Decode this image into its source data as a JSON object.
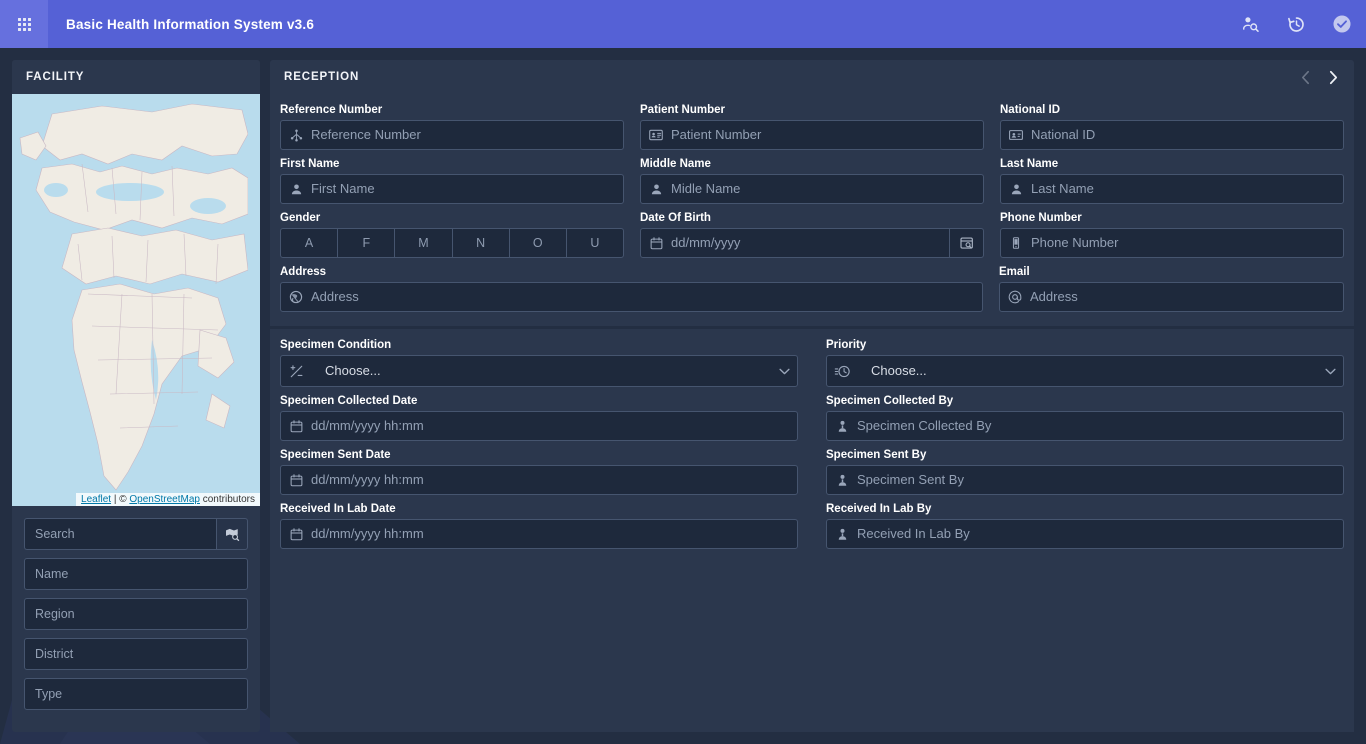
{
  "appbar": {
    "launcher_icon": "apps-grid-icon",
    "title": "Basic Health Information System v3.6",
    "actions": [
      {
        "name": "patient-search-icon",
        "label": "Search Patient"
      },
      {
        "name": "history-restore-icon",
        "label": "History"
      },
      {
        "name": "check-circle-icon",
        "label": "Confirm"
      }
    ]
  },
  "facility": {
    "title": "FACILITY",
    "map": {
      "attribution_prefix": "",
      "leaflet": "Leaflet",
      "separator": " | ",
      "copyright": "© ",
      "osm": "OpenStreetMap",
      "suffix": " contributors"
    },
    "search": {
      "placeholder": "Search",
      "button_icon": "map-search-icon"
    },
    "filters": [
      {
        "name": "facility-name-input",
        "placeholder": "Name"
      },
      {
        "name": "facility-region-input",
        "placeholder": "Region"
      },
      {
        "name": "facility-district-input",
        "placeholder": "District"
      },
      {
        "name": "facility-type-input",
        "placeholder": "Type"
      }
    ]
  },
  "reception": {
    "title": "RECEPTION",
    "nav": {
      "prev_icon": "chevron-left-icon",
      "next_icon": "chevron-right-icon",
      "prev_disabled": true
    },
    "patient": {
      "reference_number": {
        "label": "Reference Number",
        "placeholder": "Reference Number",
        "value": "",
        "icon": "hierarchy-icon"
      },
      "patient_number": {
        "label": "Patient Number",
        "placeholder": "Patient Number",
        "value": "",
        "icon": "id-card-icon"
      },
      "national_id": {
        "label": "National ID",
        "placeholder": "National ID",
        "value": "",
        "icon": "id-photo-icon"
      },
      "first_name": {
        "label": "First Name",
        "placeholder": "First Name",
        "value": "",
        "icon": "person-icon"
      },
      "middle_name": {
        "label": "Middle Name",
        "placeholder": "Midle Name",
        "value": "",
        "icon": "person-icon"
      },
      "last_name": {
        "label": "Last Name",
        "placeholder": "Last Name",
        "value": "",
        "icon": "person-icon"
      },
      "gender": {
        "label": "Gender",
        "options": [
          "A",
          "F",
          "M",
          "N",
          "O",
          "U"
        ],
        "selected": ""
      },
      "date_of_birth": {
        "label": "Date Of Birth",
        "placeholder": "dd/mm/yyyy",
        "value": "",
        "icon": "calendar-icon",
        "trailing_icon": "calendar-search-icon"
      },
      "phone_number": {
        "label": "Phone Number",
        "placeholder": "Phone Number",
        "value": "",
        "icon": "mobile-phone-icon"
      },
      "address": {
        "label": "Address",
        "placeholder": "Address",
        "value": "",
        "icon": "globe-icon"
      },
      "email": {
        "label": "Email",
        "placeholder": "Address",
        "value": "",
        "icon": "at-sign-icon"
      }
    },
    "specimen": {
      "specimen_condition": {
        "label": "Specimen Condition",
        "value": "Choose...",
        "icon": "plus-minus-icon",
        "caret": "chevron-down-icon"
      },
      "priority": {
        "label": "Priority",
        "value": "Choose...",
        "icon": "clock-list-icon",
        "caret": "chevron-down-icon"
      },
      "collected_date": {
        "label": "Specimen Collected Date",
        "placeholder": "dd/mm/yyyy hh:mm",
        "value": "",
        "icon": "calendar-icon"
      },
      "collected_by": {
        "label": "Specimen Collected By",
        "placeholder": "Specimen Collected By",
        "value": "",
        "icon": "doctor-icon"
      },
      "sent_date": {
        "label": "Specimen Sent Date",
        "placeholder": "dd/mm/yyyy hh:mm",
        "value": "",
        "icon": "calendar-icon"
      },
      "sent_by": {
        "label": "Specimen Sent By",
        "placeholder": "Specimen Sent By",
        "value": "",
        "icon": "doctor-icon"
      },
      "received_date": {
        "label": "Received In Lab Date",
        "placeholder": "dd/mm/yyyy hh:mm",
        "value": "",
        "icon": "calendar-icon"
      },
      "received_by": {
        "label": "Received In Lab By",
        "placeholder": "Received In Lab By",
        "value": "",
        "icon": "doctor-icon"
      }
    }
  },
  "colors": {
    "accent": "#5561d6",
    "panel": "#2b374d",
    "page_background": "#232e42",
    "field_background": "#1e293c",
    "field_border": "#46556f",
    "label_text": "#ffffff",
    "placeholder_text": "#93a0b4",
    "map_water": "#b9dced",
    "map_land": "#f0ece4"
  }
}
